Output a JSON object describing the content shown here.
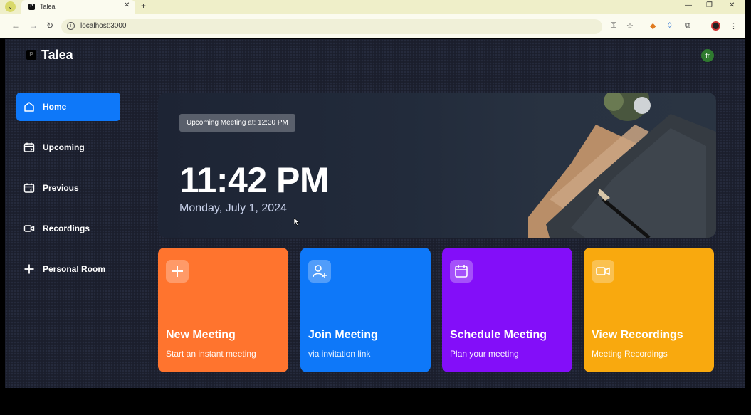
{
  "browser": {
    "tab_title": "Talea",
    "tab_favicon": "P",
    "url": "localhost:3000"
  },
  "app": {
    "logo_mark": "P",
    "name": "Talea",
    "user_initials": "fr"
  },
  "sidebar": {
    "items": [
      {
        "label": "Home",
        "icon": "home-icon",
        "active": true
      },
      {
        "label": "Upcoming",
        "icon": "calendar-upcoming-icon",
        "active": false
      },
      {
        "label": "Previous",
        "icon": "calendar-previous-icon",
        "active": false
      },
      {
        "label": "Recordings",
        "icon": "video-icon",
        "active": false
      },
      {
        "label": "Personal Room",
        "icon": "plus-icon",
        "active": false
      }
    ]
  },
  "hero": {
    "upcoming_meeting": "Upcoming Meeting at: 12:30 PM",
    "time": "11:42 PM",
    "date": "Monday, July 1, 2024"
  },
  "cards": [
    {
      "title": "New Meeting",
      "subtitle": "Start an instant meeting",
      "icon": "plus-icon",
      "color": "#ff742e"
    },
    {
      "title": "Join Meeting",
      "subtitle": "via invitation link",
      "icon": "add-user-icon",
      "color": "#0e78f9"
    },
    {
      "title": "Schedule Meeting",
      "subtitle": "Plan your meeting",
      "icon": "calendar-icon",
      "color": "#830ef9"
    },
    {
      "title": "View Recordings",
      "subtitle": "Meeting Recordings",
      "icon": "video-icon",
      "color": "#f9a90e"
    }
  ]
}
